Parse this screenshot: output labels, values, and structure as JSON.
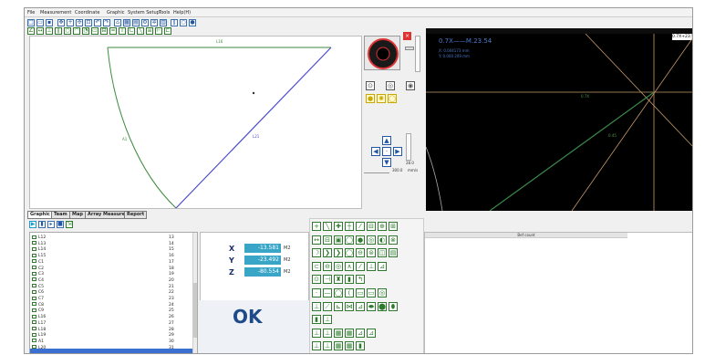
{
  "menubar": {
    "items": [
      "File",
      "Measurement",
      "Coordinate",
      "Graphic",
      "System Setup",
      "Tools",
      "Help(H)"
    ]
  },
  "tabs": [
    "Graphic",
    "Team",
    "Map",
    "Array Measure",
    "Report"
  ],
  "graphic": {
    "labels": {
      "top": "L16",
      "left": "A1",
      "middle": "L21"
    }
  },
  "controls": {
    "speed_value": "300.0",
    "speed_unit": "mm/s",
    "counter_value": "28.0"
  },
  "camera": {
    "header_label": "0.7X+23.54",
    "overlay_title": "0.7X——M.23.54",
    "overlay_line1": "X: 0.004173 mm",
    "overlay_line2": "Y: 0.000 209 mm",
    "crosshair_label": "0.7X",
    "diag_label": "0.45"
  },
  "list": {
    "items": [
      {
        "name": "L12",
        "num": "13"
      },
      {
        "name": "L13",
        "num": "14"
      },
      {
        "name": "L14",
        "num": "15"
      },
      {
        "name": "L15",
        "num": "16"
      },
      {
        "name": "C1",
        "num": "17"
      },
      {
        "name": "C2",
        "num": "18"
      },
      {
        "name": "C3",
        "num": "19"
      },
      {
        "name": "C4",
        "num": "20"
      },
      {
        "name": "C5",
        "num": "21"
      },
      {
        "name": "C6",
        "num": "22"
      },
      {
        "name": "C7",
        "num": "23"
      },
      {
        "name": "C8",
        "num": "24"
      },
      {
        "name": "C9",
        "num": "25"
      },
      {
        "name": "L16",
        "num": "26"
      },
      {
        "name": "L17",
        "num": "27"
      },
      {
        "name": "L18",
        "num": "28"
      },
      {
        "name": "L19",
        "num": "29"
      },
      {
        "name": "A1",
        "num": "30"
      },
      {
        "name": "L20",
        "num": "31"
      }
    ]
  },
  "result_panel": {
    "header": "Bef count"
  },
  "coords": [
    {
      "axis": "X",
      "value": "-13.581",
      "unit": "M2"
    },
    {
      "axis": "Y",
      "value": "-23.492",
      "unit": "M2"
    },
    {
      "axis": "Z",
      "value": "-80.554",
      "unit": "M2"
    }
  ],
  "status": {
    "ok": "OK"
  },
  "colors": {
    "accent": "#3aa6c7",
    "graph_green": "#3c8a3c",
    "graph_blue": "#4a4ad0",
    "camera_bg": "#000000",
    "ok_text": "#1f4a8a"
  }
}
